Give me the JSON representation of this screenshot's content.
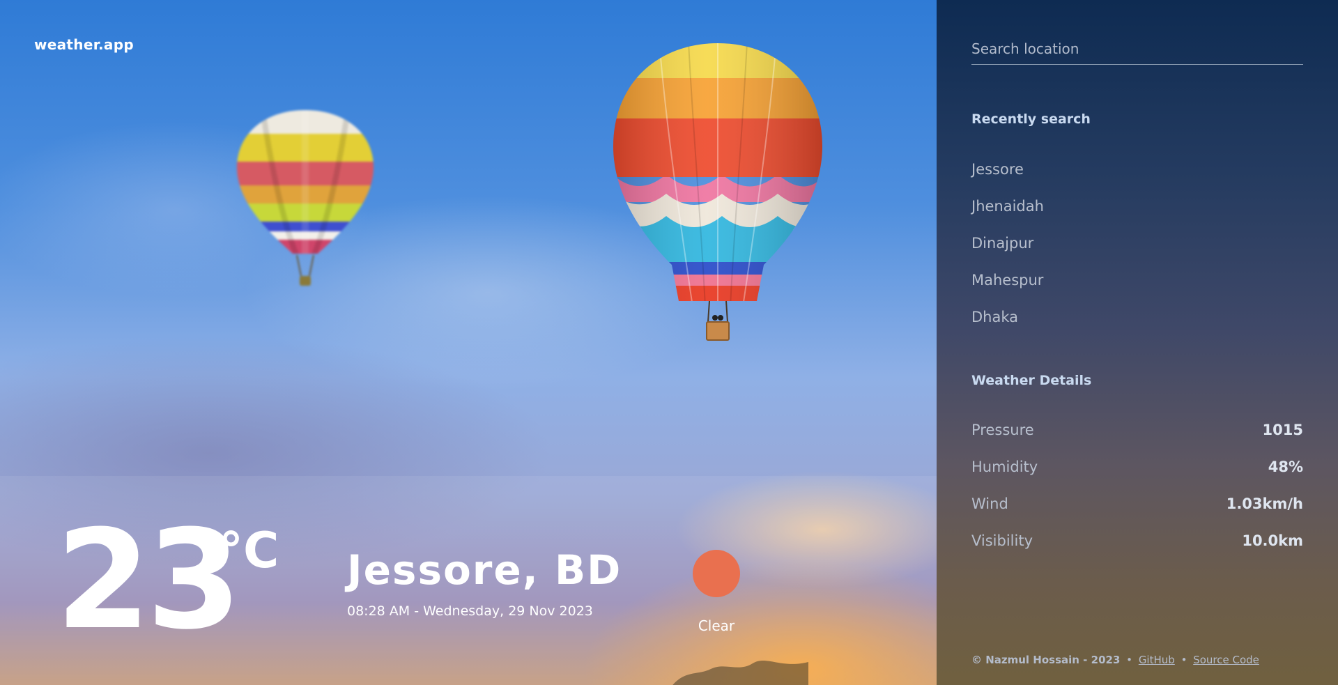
{
  "app": {
    "brand": "weather.app"
  },
  "current": {
    "temperature": "23",
    "unit": "°C",
    "location": "Jessore, BD",
    "datetime": "08:28 AM - Wednesday, 29 Nov 2023",
    "condition": "Clear",
    "condition_icon": "sun-icon",
    "condition_color": "#e9704f"
  },
  "search": {
    "placeholder": "Search location"
  },
  "recent": {
    "title": "Recently search",
    "items": [
      "Jessore",
      "Jhenaidah",
      "Dinajpur",
      "Mahespur",
      "Dhaka"
    ]
  },
  "details": {
    "title": "Weather Details",
    "rows": [
      {
        "label": "Pressure",
        "value": "1015"
      },
      {
        "label": "Humidity",
        "value": "48%"
      },
      {
        "label": "Wind",
        "value": "1.03km/h"
      },
      {
        "label": "Visibility",
        "value": "10.0km"
      }
    ]
  },
  "footer": {
    "copyright": "© Nazmul Hossain - 2023",
    "separator": "•",
    "github_label": "GitHub",
    "source_label": "Source Code"
  },
  "theme": {
    "panel_top": "#0e2b52",
    "panel_bottom": "#70603f",
    "sky": "#2f7bd6"
  }
}
